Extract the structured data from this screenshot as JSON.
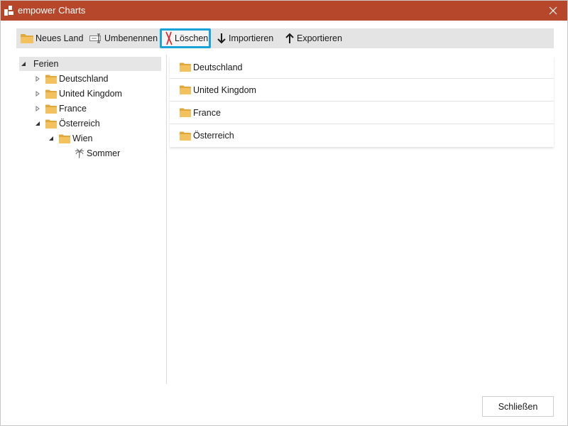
{
  "window": {
    "title": "empower Charts",
    "accent_color": "#b7472a"
  },
  "toolbar": {
    "new_country_label": "Neues Land",
    "rename_label": "Umbenennen",
    "delete_label": "Löschen",
    "import_label": "Importieren",
    "export_label": "Exportieren",
    "selected_highlight_color": "#1aa3d9"
  },
  "tree": {
    "root": {
      "label": "Ferien",
      "expanded": true
    },
    "items": [
      {
        "label": "Deutschland",
        "expanded": false,
        "icon": "folder-icon"
      },
      {
        "label": "United Kingdom",
        "expanded": false,
        "icon": "folder-icon"
      },
      {
        "label": "France",
        "expanded": false,
        "icon": "folder-icon"
      },
      {
        "label": "Österreich",
        "expanded": true,
        "icon": "folder-icon"
      },
      {
        "label": "Wien",
        "expanded": true,
        "icon": "folder-icon"
      },
      {
        "label": "Sommer",
        "icon": "palm-tree-icon"
      }
    ]
  },
  "list": {
    "items": [
      {
        "label": "Deutschland",
        "icon": "folder-icon"
      },
      {
        "label": "United Kingdom",
        "icon": "folder-icon"
      },
      {
        "label": "France",
        "icon": "folder-icon"
      },
      {
        "label": "Österreich",
        "icon": "folder-icon"
      }
    ]
  },
  "footer": {
    "close_button_label": "Schließen"
  },
  "colors": {
    "folder": "#f3c25e",
    "folder_dark": "#e0a83b",
    "delete_red": "#e02020"
  }
}
